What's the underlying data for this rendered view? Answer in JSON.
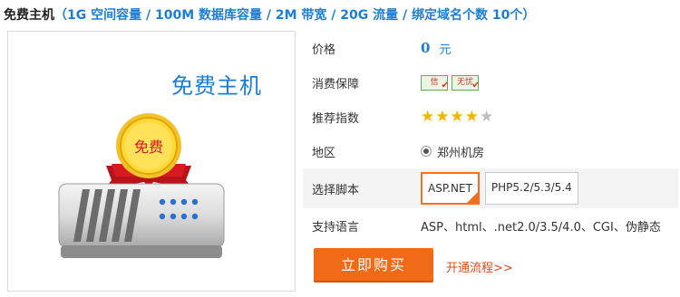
{
  "header": {
    "title": "免费主机",
    "spec": "（1G 空间容量 / 100M 数据库容量 / 2M 带宽 / 20G 流量 / 绑定域名个数 10个）"
  },
  "product": {
    "name": "免费主机",
    "medal_text": "免费"
  },
  "info": {
    "price_label": "价格",
    "price_value": "0",
    "price_unit": "元",
    "guarantee_label": "消费保障",
    "guarantee_badges": [
      "信",
      "无忧"
    ],
    "rating_label": "推荐指数",
    "rating_value": 4.5,
    "rating_max": 5,
    "region_label": "地区",
    "region_value": "郑州机房",
    "script_label": "选择脚本",
    "script_options": [
      "ASP.NET",
      "PHP5.2/5.3/5.4"
    ],
    "script_selected": "ASP.NET",
    "lang_label": "支持语言",
    "lang_value": "ASP、html、.net2.0/3.5/4.0、CGI、伪静态"
  },
  "actions": {
    "buy_label": "立即购买",
    "flow_link": "开通流程>>"
  },
  "colors": {
    "accent_blue": "#1a7ed6",
    "buy_orange": "#f06a18",
    "star_gold": "#f3b400"
  }
}
